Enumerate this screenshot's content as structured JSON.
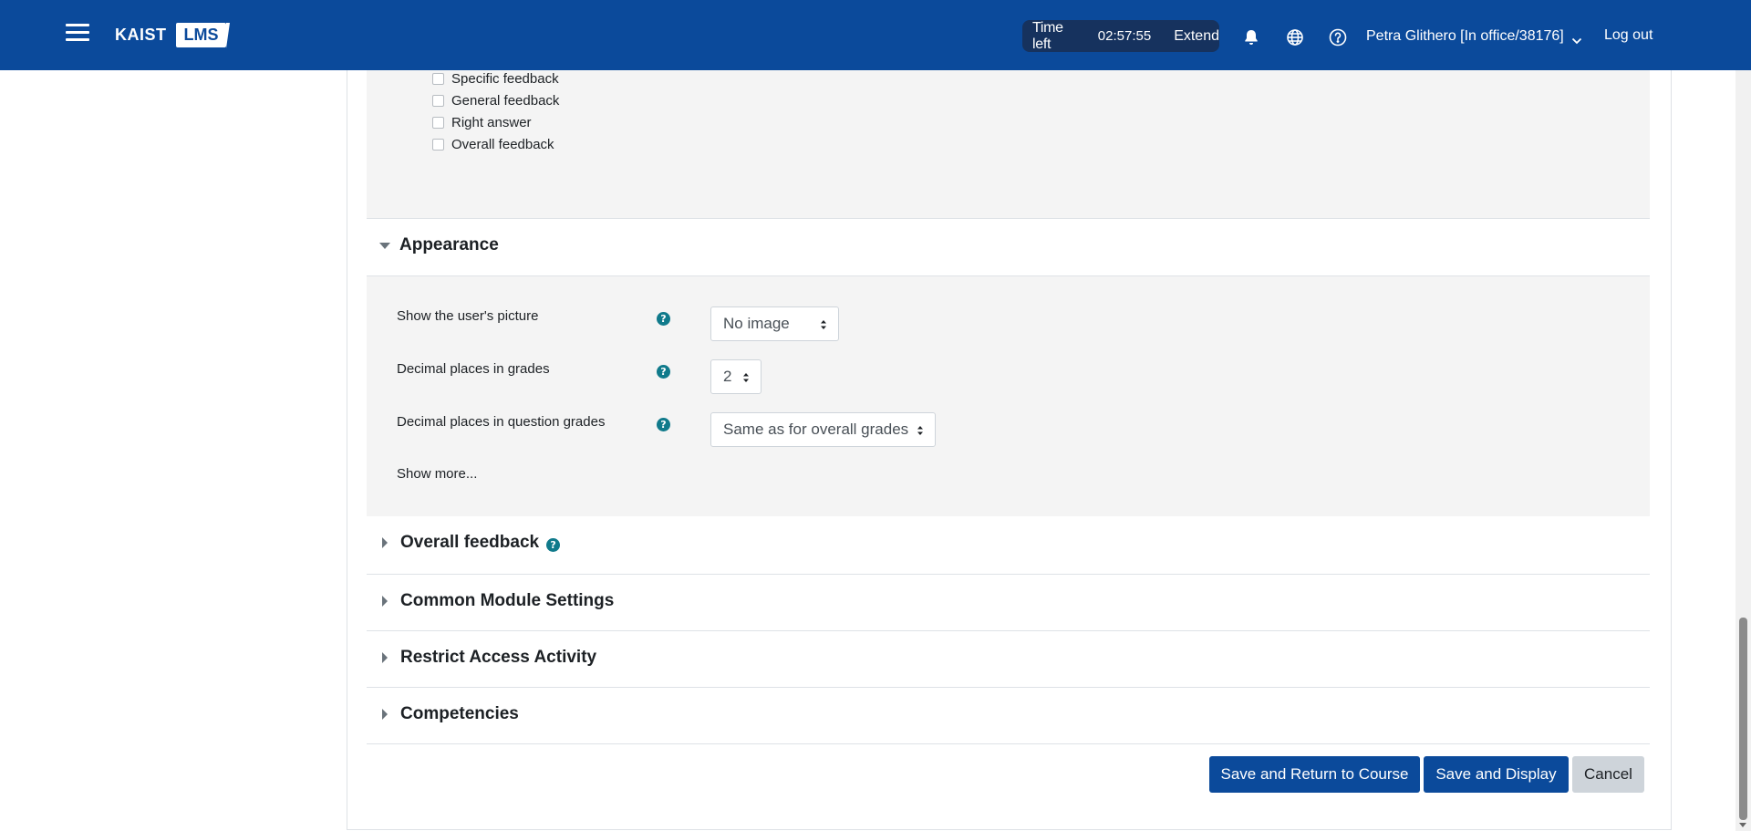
{
  "navbar": {
    "menu_icon": "hamburger-menu-icon",
    "logo_text": "KAIST",
    "logo_badge": "LMS",
    "timer": {
      "label": "Time left",
      "value": "02:57:55",
      "extend_label": "Extend"
    },
    "icons": [
      "bell-icon",
      "globe-icon",
      "help-circle-icon"
    ],
    "user_label": "Petra Glithero [In office/38176]",
    "logout_label": "Log out"
  },
  "review_options": {
    "checkboxes": [
      {
        "label": "Specific feedback",
        "checked": false
      },
      {
        "label": "General feedback",
        "checked": false
      },
      {
        "label": "Right answer",
        "checked": false
      },
      {
        "label": "Overall feedback",
        "checked": false
      }
    ]
  },
  "appearance": {
    "title": "Appearance",
    "fields": [
      {
        "label": "Show the user's picture",
        "value": "No image"
      },
      {
        "label": "Decimal places in grades",
        "value": "2"
      },
      {
        "label": "Decimal places in question grades",
        "value": "Same as for overall grades"
      }
    ],
    "show_more": "Show more..."
  },
  "sections": [
    {
      "title": "Overall feedback",
      "has_help": true
    },
    {
      "title": "Common Module Settings",
      "has_help": false
    },
    {
      "title": "Restrict Access Activity",
      "has_help": false
    },
    {
      "title": "Competencies",
      "has_help": false
    }
  ],
  "buttons": {
    "save_return": "Save and Return to Course",
    "save_display": "Save and Display",
    "cancel": "Cancel"
  },
  "colors": {
    "brand": "#0b4a9b",
    "timer_bg": "#16325e",
    "help_icon": "#107a8b",
    "panel_bg": "#f4f4f4"
  }
}
